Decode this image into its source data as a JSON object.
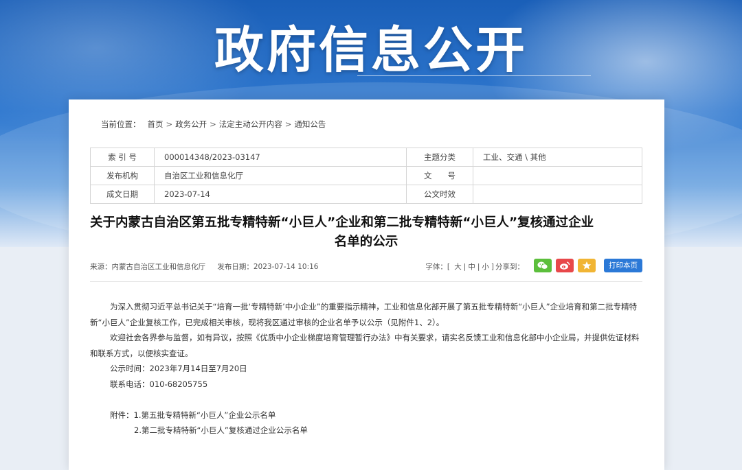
{
  "site": {
    "title": "政府信息公开"
  },
  "breadcrumb": {
    "label": "当前位置：",
    "items": [
      "首页",
      "政务公开",
      "法定主动公开内容",
      "通知公告"
    ],
    "separator": ">"
  },
  "meta": {
    "index_label": "索 引 号",
    "index_value": "000014348/2023-03147",
    "topic_label": "主题分类",
    "topic_value": "工业、交通 \\ 其他",
    "issuer_label": "发布机构",
    "issuer_value": "自治区工业和信息化厅",
    "docno_label": "文　　号",
    "docno_value": "",
    "date_label": "成文日期",
    "date_value": "2023-07-14",
    "validity_label": "公文时效",
    "validity_value": ""
  },
  "article": {
    "title_line1": "关于内蒙古自治区第五批专精特新“小巨人”企业和第二批专精特新“小巨人”复核通过企业",
    "title_line2": "名单的公示",
    "source": "来源：内蒙古自治区工业和信息化厅",
    "publish_date": "发布日期：2023-07-14 10:16",
    "font_label": "字体：[",
    "font_large": "大",
    "font_medium": "中",
    "font_small": "小",
    "font_end": "]",
    "share_label": "分享到：",
    "print_label": "打印本页",
    "paragraph1": "为深入贯彻习近平总书记关于“培育一批‘专精特新’中小企业”的重要指示精神，工业和信息化部开展了第五批专精特新“小巨人”企业培育和第二批专精特新“小巨人”企业复核工作，已完成相关审核，现将我区通过审核的企业名单予以公示（见附件1、2）。",
    "paragraph2": "欢迎社会各界参与监督，如有异议，按照《优质中小企业梯度培育管理暂行办法》中有关要求，请实名反馈工业和信息化部中小企业局，并提供佐证材料和联系方式，以便核实查证。",
    "period": "公示时间：2023年7月14日至7月20日",
    "phone": "联系电话：010-68205755",
    "attachment1": "附件：1.第五批专精特新“小巨人”企业公示名单",
    "attachment2": "2.第二批专精特新“小巨人”复核通过企业公示名单"
  },
  "icons": {
    "wechat": "wechat-icon",
    "weibo": "weibo-icon",
    "qzone": "qzone-star-icon"
  },
  "colors": {
    "banner": "#2f78cf",
    "print_button": "#2b79d7",
    "wechat": "#5cbf3c",
    "weibo": "#e8484a",
    "qzone": "#f1b534"
  }
}
